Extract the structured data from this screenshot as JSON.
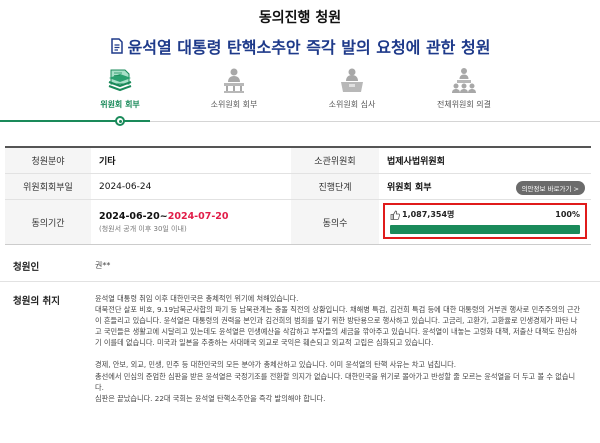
{
  "header": {
    "heading": "동의진행 청원",
    "title": "윤석열 대통령 탄핵소추안 즉각 발의 요청에 관한 청원"
  },
  "steps": [
    {
      "label": "위원회 회부",
      "icon": "stack-icon",
      "active": true
    },
    {
      "label": "소위원회 회부",
      "icon": "person-podium-icon",
      "active": false
    },
    {
      "label": "소위원회 심사",
      "icon": "person-desk-icon",
      "active": false
    },
    {
      "label": "전체위원회 의결",
      "icon": "group-podium-icon",
      "active": false
    }
  ],
  "info": {
    "field_label": "청원분야",
    "field_value": "기타",
    "committee_label": "소관위원회",
    "committee_value": "법제사법위원회",
    "referral_date_label": "위원회회부일",
    "referral_date_value": "2024-06-24",
    "stage_label": "진행단계",
    "stage_value": "위원회 회부",
    "ext_button": "의안정보 바로가기 >",
    "period_label": "동의기간",
    "period_start": "2024-06-20~",
    "period_end": "2024-07-20",
    "period_note": "(청원서 공개 이후 30일 이내)",
    "agree_label": "동의수",
    "agree_count": "1,087,354명",
    "agree_percent": "100%",
    "agree_fraction": 1.0
  },
  "petitioner": {
    "label": "청원인",
    "value": "권**"
  },
  "purpose": {
    "label": "청원의 취지",
    "paragraphs": [
      "윤석열 대통령 취임 이후 대한민국은 총체적인 위기에 처해있습니다.\n대북전단 살포 비호, 9.19남북군사합의 파기 등 남북관계는 충돌 직전의 상황입니다. 채해병 특검, 김건희 특검 등에 대한 대통령의 거부권 행사로 민주주의의 근간이 흔들리고 있습니다. 윤석열은 대통령의 권력을 본인과 김건희의 범죄를 덮기 위한 방탄용으로 행사하고 있습니다. 고금리, 고환가, 고환율로 민생경제가 파탄 나고 국민들은 생활고에 시달리고 있는데도 윤석열은 민생예산을 삭감하고 부자들의 세금을 깎아주고 있습니다. 윤석열이 내놓는 고령화 대책, 저출산 대책도 한심하기 이를데 없습니다. 미국과 일본을 추종하는 사대매국 외교로 국익은 훼손되고 외교적 고립은 심화되고 있습니다.",
      "경제, 안보, 외교, 민생, 민주 등 대한민국의 모든 분야가 총체산하고 있습니다. 이미 윤석열의 탄핵 사유는 차고 넘칩니다.\n총선에서 민심의 준엄한 심판을 받은 윤석열은 국정기조를 전환할 의지가 없습니다. 대한민국을 위기로 몰아가고 반성할 줄 모르는 윤석열을 더 두고 볼 수 없습니다.\n심판은 끝났습니다. 22대 국회는 윤석열 탄핵소추안을 즉각 발의해야 합니다."
    ]
  }
}
